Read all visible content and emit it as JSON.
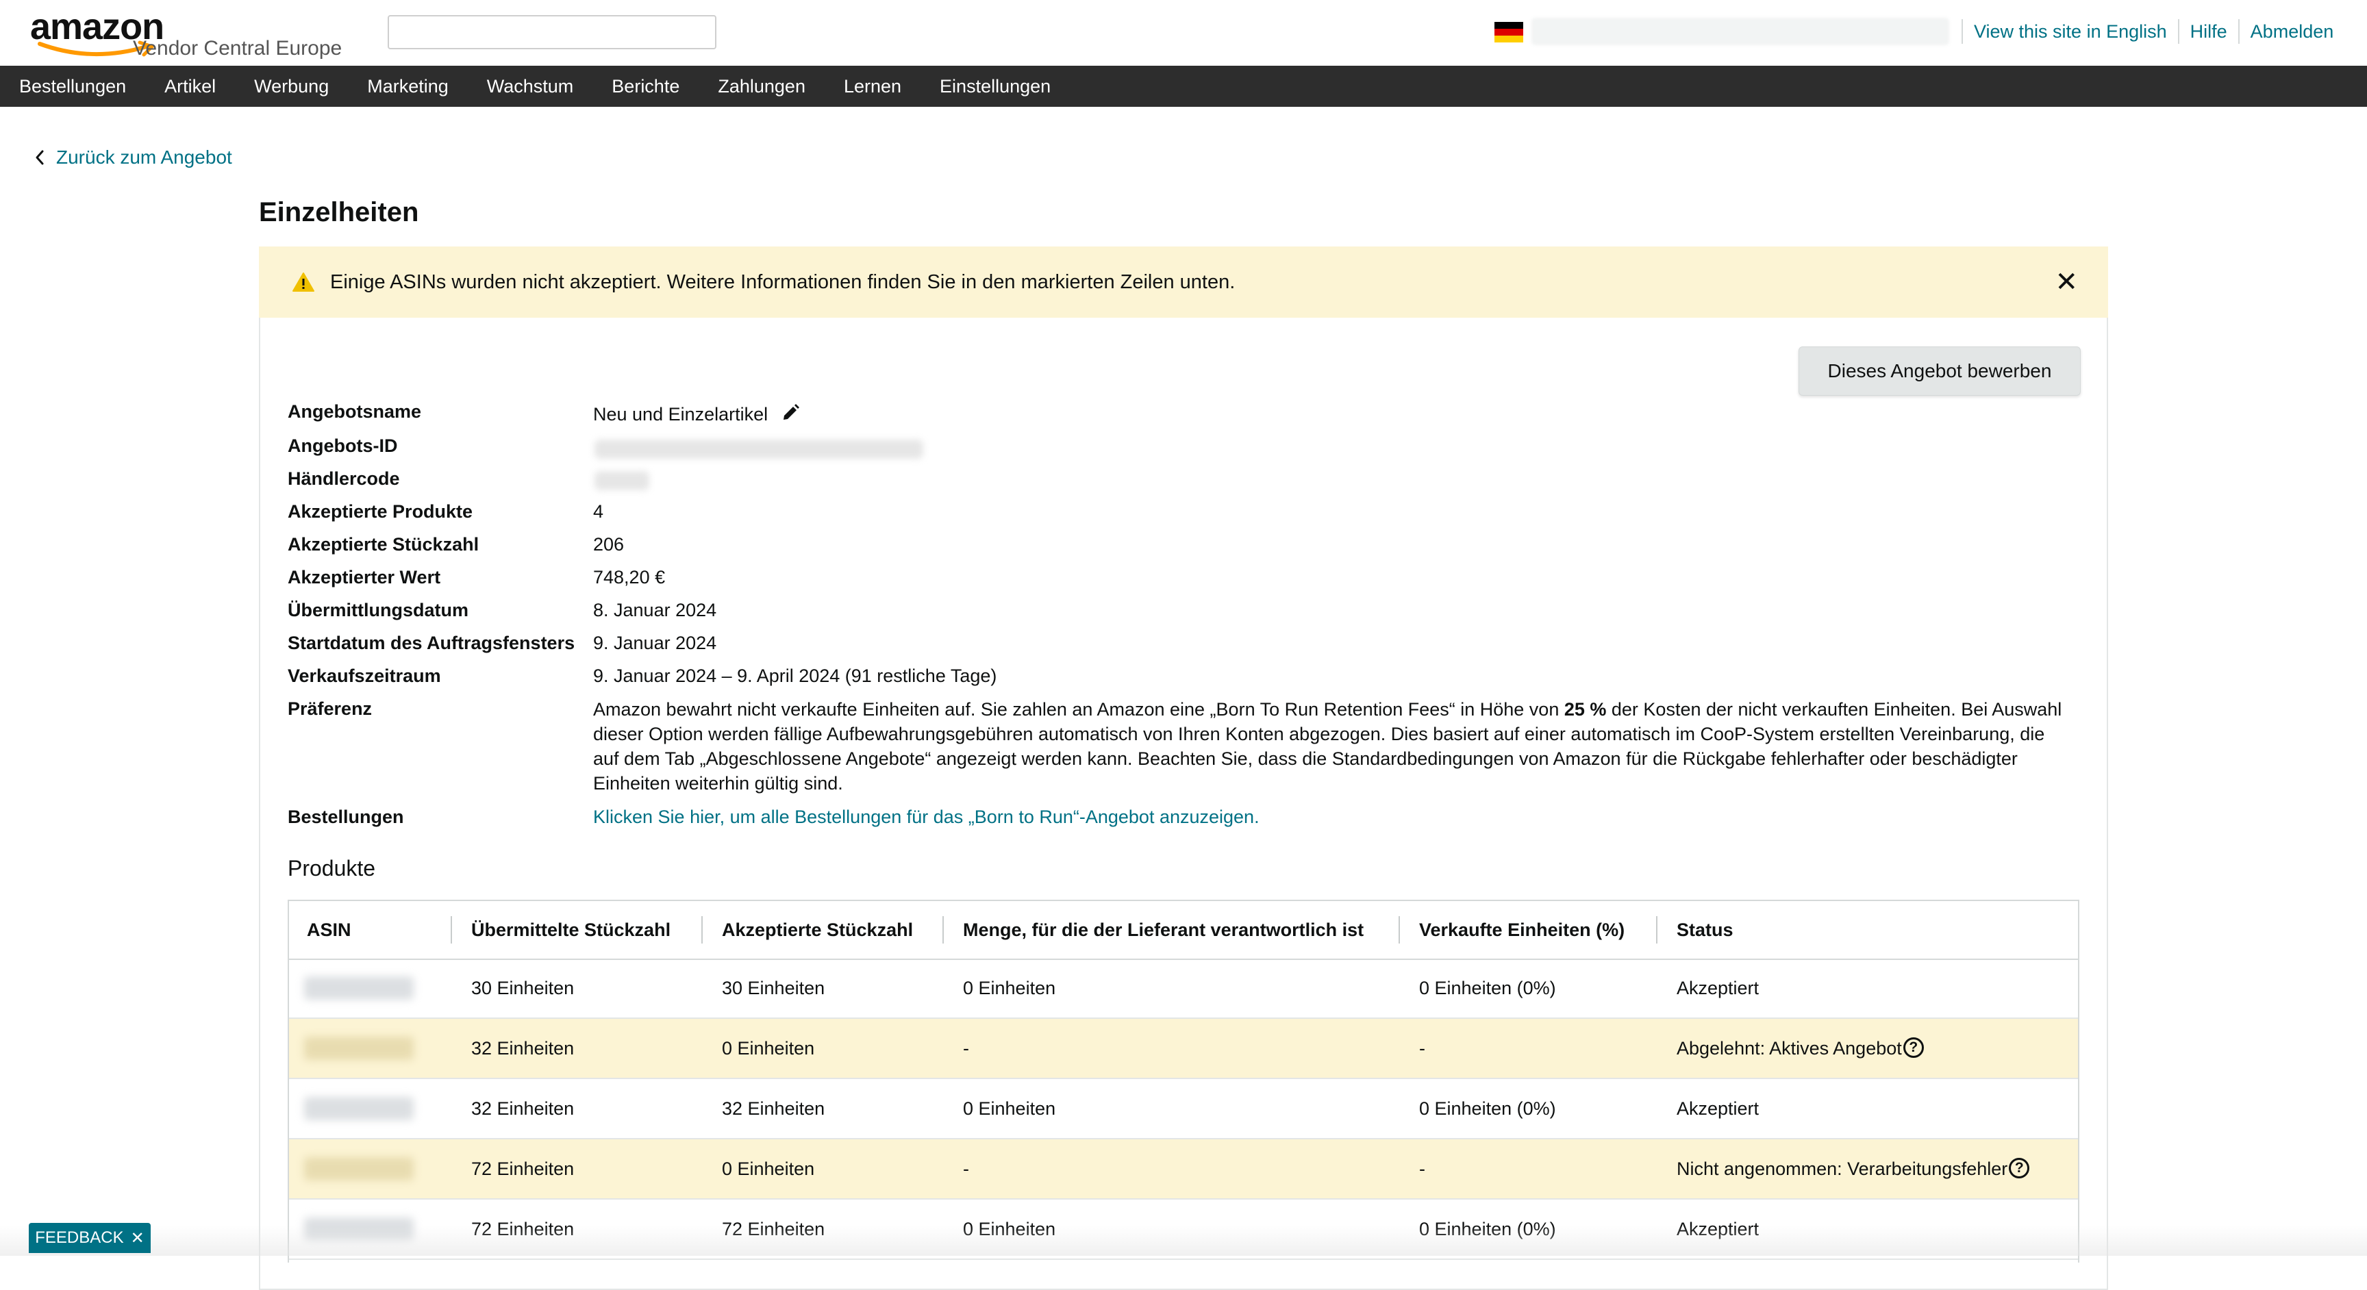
{
  "header": {
    "logo_text": "amazon",
    "logo_sub": "Vendor Central Europe",
    "links": [
      "View this site in English",
      "Hilfe",
      "Abmelden"
    ],
    "flag_colors": [
      "#000000",
      "#dd0000",
      "#ffce00"
    ]
  },
  "nav": {
    "items": [
      "Bestellungen",
      "Artikel",
      "Werbung",
      "Marketing",
      "Wachstum",
      "Berichte",
      "Zahlungen",
      "Lernen",
      "Einstellungen"
    ]
  },
  "back_link": "Zurück zum Angebot",
  "page_title": "Einzelheiten",
  "alert": {
    "text": "Einige ASINs wurden nicht akzeptiert. Weitere Informationen finden Sie in den markierten Zeilen unten.",
    "close_glyph": "✕"
  },
  "bid_button": "Dieses Angebot bewerben",
  "details": {
    "labels": {
      "name": "Angebotsname",
      "id": "Angebots-ID",
      "vendor_code": "Händlercode",
      "accepted_products": "Akzeptierte Produkte",
      "accepted_units": "Akzeptierte Stückzahl",
      "accepted_value": "Akzeptierter Wert",
      "submission_date": "Übermittlungsdatum",
      "order_window_start": "Startdatum des Auftragsfensters",
      "sales_period": "Verkaufszeitraum",
      "preference": "Präferenz",
      "orders": "Bestellungen"
    },
    "values": {
      "name": "Neu und Einzelartikel",
      "accepted_products": "4",
      "accepted_units": "206",
      "accepted_value": "748,20 €",
      "submission_date": "8. Januar 2024",
      "order_window_start": "9. Januar 2024",
      "sales_period": "9. Januar 2024 – 9. April 2024 (91 restliche Tage)",
      "preference_before": "Amazon bewahrt nicht verkaufte Einheiten auf. Sie zahlen an Amazon eine „Born To Run Retention Fees“ in Höhe von ",
      "preference_bold": "25 %",
      "preference_after": " der Kosten der nicht verkauften Einheiten. Bei Auswahl dieser Option werden fällige Aufbewahrungsgebühren automatisch von Ihren Konten abgezogen. Dies basiert auf einer automatisch im CooP-System erstellten Vereinbarung, die auf dem Tab „Abgeschlossene Angebote“ angezeigt werden kann. Beachten Sie, dass die Standardbedingungen von Amazon für die Rückgabe fehlerhafter oder beschädigter Einheiten weiterhin gültig sind.",
      "orders_link": "Klicken Sie hier, um alle Bestellungen für das „Born to Run“-Angebot anzuzeigen."
    }
  },
  "products": {
    "title": "Produkte",
    "columns": [
      "ASIN",
      "Übermittelte Stückzahl",
      "Akzeptierte Stückzahl",
      "Menge, für die der Lieferant verantwortlich ist",
      "Verkaufte Einheiten (%)",
      "Status"
    ],
    "rows": [
      {
        "submitted": "30 Einheiten",
        "accepted": "30 Einheiten",
        "responsible": "0 Einheiten",
        "sold": "0 Einheiten (0%)",
        "status": "Akzeptiert",
        "flagged": false
      },
      {
        "submitted": "32 Einheiten",
        "accepted": "0 Einheiten",
        "responsible": "-",
        "sold": "-",
        "status": "Abgelehnt: Aktives Angebot",
        "flagged": true
      },
      {
        "submitted": "32 Einheiten",
        "accepted": "32 Einheiten",
        "responsible": "0 Einheiten",
        "sold": "0 Einheiten (0%)",
        "status": "Akzeptiert",
        "flagged": false
      },
      {
        "submitted": "72 Einheiten",
        "accepted": "0 Einheiten",
        "responsible": "-",
        "sold": "-",
        "status": "Nicht angenommen: Verarbeitungsfehler",
        "flagged": true
      },
      {
        "submitted": "72 Einheiten",
        "accepted": "72 Einheiten",
        "responsible": "0 Einheiten",
        "sold": "0 Einheiten (0%)",
        "status": "Akzeptiert",
        "flagged": false
      }
    ],
    "help_glyph": "?"
  },
  "feedback": {
    "label": "FEEDBACK",
    "close_glyph": "✕"
  },
  "colors": {
    "link": "#007185",
    "nav_bg": "#2d2d2d",
    "alert_bg": "#fcf4d4",
    "warning": "#f0c000"
  }
}
